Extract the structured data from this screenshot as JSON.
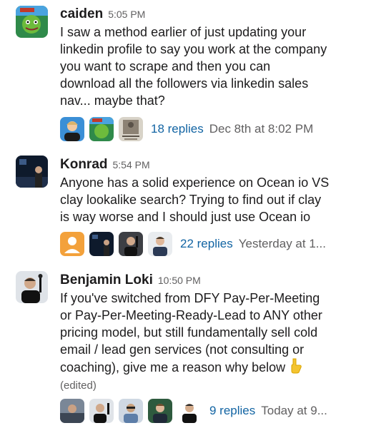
{
  "messages": [
    {
      "author": "caiden",
      "time": "5:05 PM",
      "lines": [
        "I saw a method earlier of just updating your",
        "linkedin profile to say you work at the company",
        "you want to scrape and then you can",
        "download all the followers via linkedin sales",
        "nav... maybe that?"
      ],
      "thread": {
        "replies": "18 replies",
        "last_reply": "Dec 8th at 8:02 PM"
      }
    },
    {
      "author": "Konrad",
      "time": "5:54 PM",
      "lines": [
        "Anyone has a solid experience on Ocean io VS",
        "clay lookalike search? Trying to find out if clay",
        "is way worse and I should just use Ocean io"
      ],
      "thread": {
        "replies": "22 replies",
        "last_reply": "Yesterday at 1..."
      }
    },
    {
      "author": "Benjamin Loki",
      "time": "10:50 PM",
      "lines": [
        "If you've switched from DFY Pay-Per-Meeting",
        "or Pay-Per-Meeting-Ready-Lead to ANY other",
        "pricing model, but still fundamentally sell cold",
        "email / lead gen services (not consulting or",
        "coaching), give me a reason why below"
      ],
      "edited": "(edited)",
      "thread": {
        "replies": "9 replies",
        "last_reply": "Today at 9..."
      }
    }
  ],
  "colors": {
    "link": "#1264a3",
    "muted": "#616061",
    "text": "#1d1c1d"
  },
  "icons": [
    "point-down-emoji"
  ]
}
